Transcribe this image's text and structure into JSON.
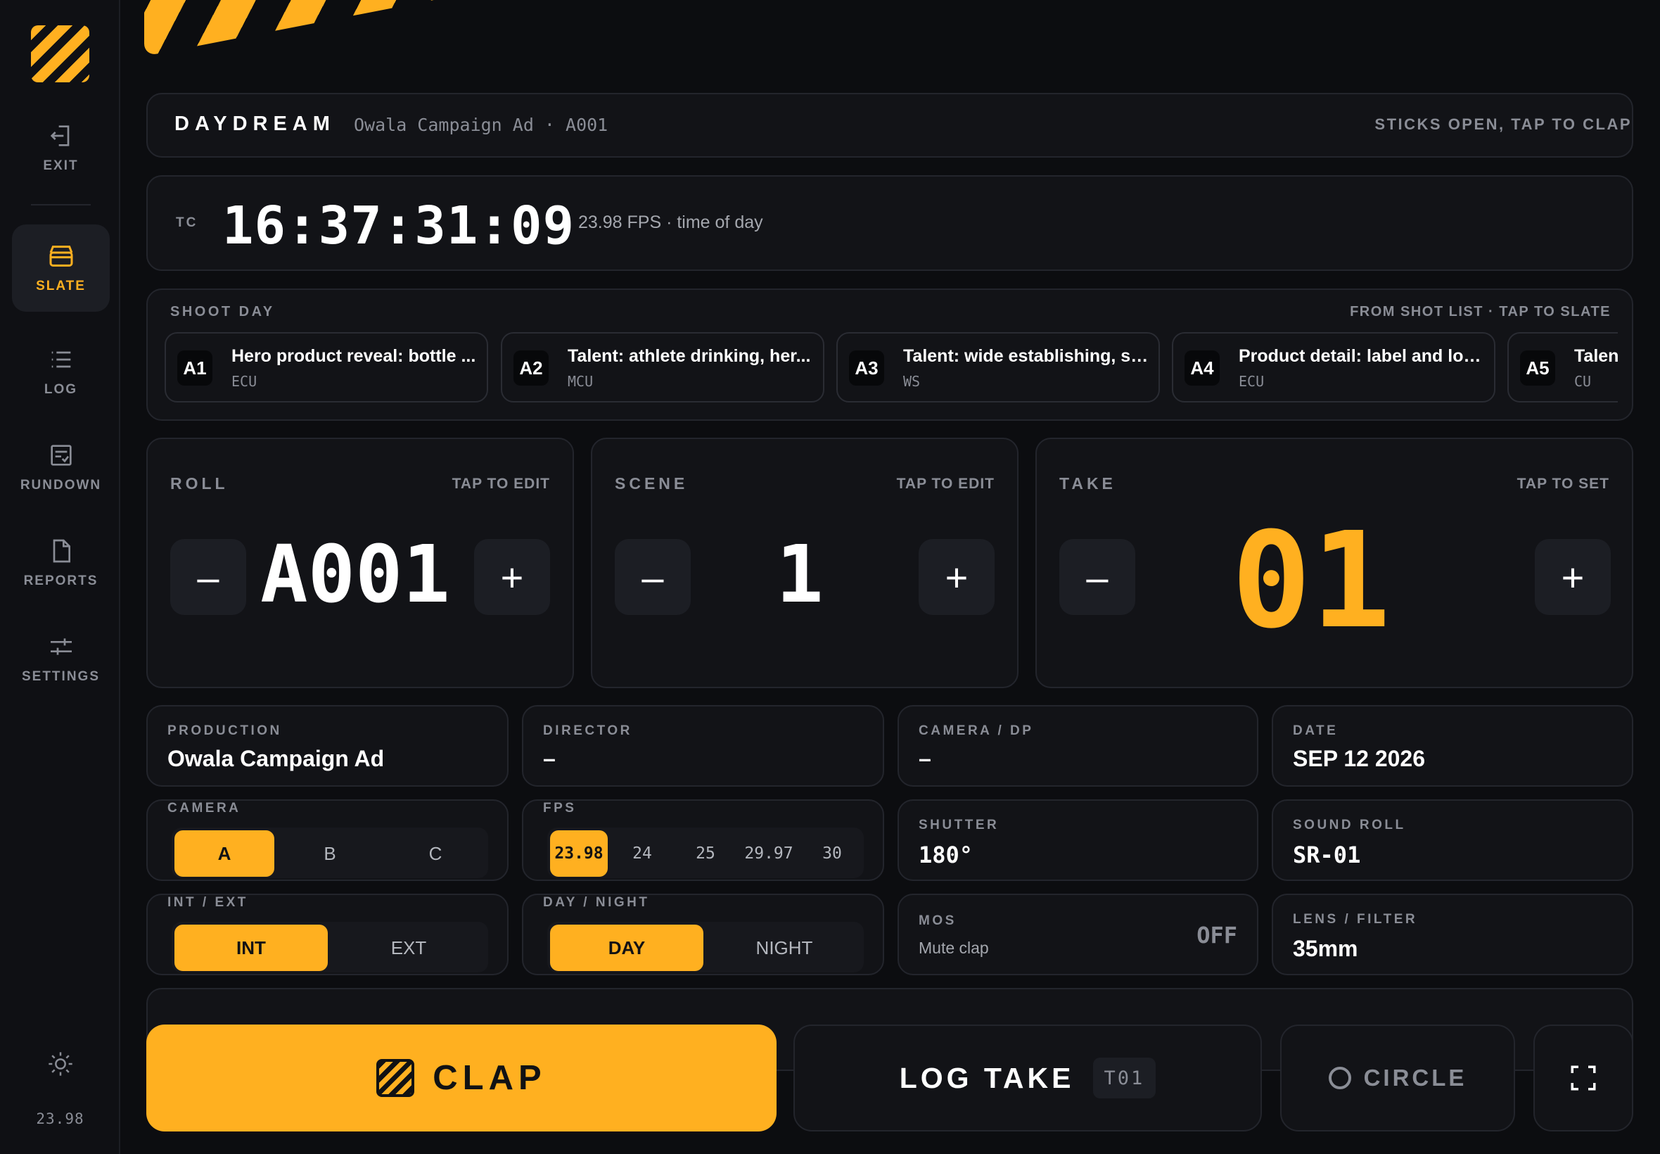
{
  "sidebar": {
    "items": [
      {
        "label": "EXIT",
        "icon": "exit-icon"
      },
      {
        "label": "SLATE",
        "icon": "clapper-icon",
        "active": true
      },
      {
        "label": "LOG",
        "icon": "list-icon"
      },
      {
        "label": "RUNDOWN",
        "icon": "rundown-icon"
      },
      {
        "label": "REPORTS",
        "icon": "document-icon"
      },
      {
        "label": "SETTINGS",
        "icon": "sliders-icon"
      }
    ],
    "fps": "23.98"
  },
  "header": {
    "brand": "DAYDREAM",
    "subtitle": "Owala Campaign Ad · A001",
    "status": "STICKS OPEN, TAP TO CLAP"
  },
  "timecode": {
    "label": "TC",
    "value": "16:37:31:09",
    "note": "23.98 FPS · time of day"
  },
  "shoot_day": {
    "label": "SHOOT DAY",
    "hint": "FROM SHOT LIST · TAP TO SLATE",
    "shots": [
      {
        "code": "A1",
        "title": "Hero product reveal: bottle ...",
        "type": "ECU"
      },
      {
        "code": "A2",
        "title": "Talent: athlete drinking, her...",
        "type": "MCU"
      },
      {
        "code": "A3",
        "title": "Talent: wide establishing, st...",
        "type": "WS"
      },
      {
        "code": "A4",
        "title": "Product detail: label and log...",
        "type": "ECU"
      },
      {
        "code": "A5",
        "title": "Talen",
        "type": "CU"
      }
    ]
  },
  "roll": {
    "label": "ROLL",
    "hint": "TAP TO EDIT",
    "value": "A001",
    "minus": "–",
    "plus": "+"
  },
  "scene": {
    "label": "SCENE",
    "hint": "TAP TO EDIT",
    "value": "1",
    "minus": "–",
    "plus": "+"
  },
  "take": {
    "label": "TAKE",
    "hint": "TAP TO SET",
    "value": "01",
    "minus": "–",
    "plus": "+"
  },
  "info": {
    "production": {
      "label": "PRODUCTION",
      "value": "Owala Campaign Ad"
    },
    "director": {
      "label": "DIRECTOR",
      "value": "–"
    },
    "camera_dp": {
      "label": "CAMERA / DP",
      "value": "–"
    },
    "date": {
      "label": "DATE",
      "value": "SEP 12 2026"
    },
    "camera": {
      "label": "CAMERA",
      "options": [
        "A",
        "B",
        "C"
      ],
      "selected": "A"
    },
    "fps": {
      "label": "FPS",
      "options": [
        "23.98",
        "24",
        "25",
        "29.97",
        "30"
      ],
      "selected": "23.98"
    },
    "shutter": {
      "label": "SHUTTER",
      "value": "180°"
    },
    "sound_roll": {
      "label": "SOUND ROLL",
      "value": "SR-01"
    },
    "int_ext": {
      "label": "INT / EXT",
      "options": [
        "INT",
        "EXT"
      ],
      "selected": "INT"
    },
    "day_night": {
      "label": "DAY / NIGHT",
      "options": [
        "DAY",
        "NIGHT"
      ],
      "selected": "DAY"
    },
    "mos": {
      "label": "MOS",
      "sub": "Mute clap",
      "value": "OFF"
    },
    "lens": {
      "label": "LENS / FILTER",
      "value": "35mm"
    }
  },
  "actions": {
    "clap": "CLAP",
    "log_take": "LOG TAKE",
    "take_badge": "T01",
    "circle": "CIRCLE"
  },
  "colors": {
    "accent": "#ffb020",
    "background": "#0c0d10",
    "panel": "#121317"
  }
}
